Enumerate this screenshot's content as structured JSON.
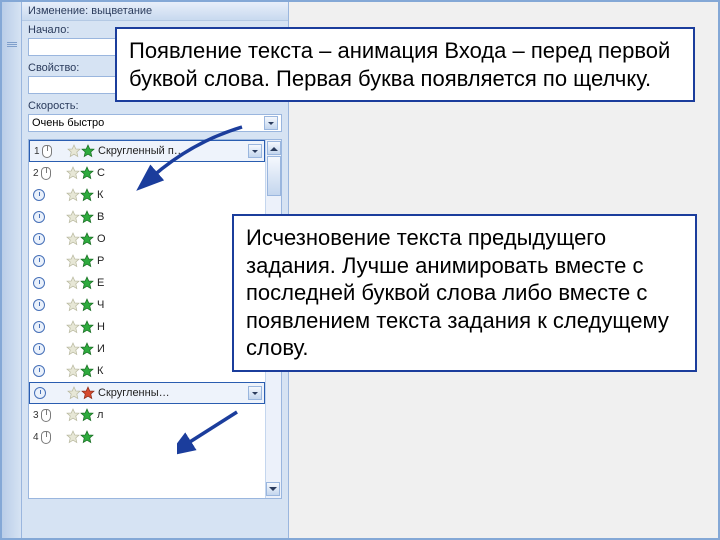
{
  "panel": {
    "title": "Изменение: выцветание",
    "start_label": "Начало:",
    "property_label": "Свойство:",
    "speed_label": "Скорость:",
    "speed_value": "Очень быстро"
  },
  "animations": [
    {
      "num": "1",
      "trigger": "mouse",
      "icons": [
        "ghost",
        "green"
      ],
      "label": "Скругленный п…",
      "selected": true
    },
    {
      "num": "2",
      "trigger": "mouse",
      "icons": [
        "ghost",
        "green"
      ],
      "label": "С"
    },
    {
      "num": "",
      "trigger": "clock",
      "icons": [
        "ghost",
        "green"
      ],
      "label": "К"
    },
    {
      "num": "",
      "trigger": "clock",
      "icons": [
        "ghost",
        "green"
      ],
      "label": "В"
    },
    {
      "num": "",
      "trigger": "clock",
      "icons": [
        "ghost",
        "green"
      ],
      "label": "О"
    },
    {
      "num": "",
      "trigger": "clock",
      "icons": [
        "ghost",
        "green"
      ],
      "label": "Р"
    },
    {
      "num": "",
      "trigger": "clock",
      "icons": [
        "ghost",
        "green"
      ],
      "label": "Е"
    },
    {
      "num": "",
      "trigger": "clock",
      "icons": [
        "ghost",
        "green"
      ],
      "label": "Ч"
    },
    {
      "num": "",
      "trigger": "clock",
      "icons": [
        "ghost",
        "green"
      ],
      "label": "Н"
    },
    {
      "num": "",
      "trigger": "clock",
      "icons": [
        "ghost",
        "green"
      ],
      "label": "И"
    },
    {
      "num": "",
      "trigger": "clock",
      "icons": [
        "ghost",
        "green"
      ],
      "label": "К"
    },
    {
      "num": "",
      "trigger": "clock",
      "icons": [
        "ghost",
        "red"
      ],
      "label": "Скругленны…",
      "selected": true
    },
    {
      "num": "3",
      "trigger": "mouse",
      "icons": [
        "ghost",
        "green"
      ],
      "label": "л"
    },
    {
      "num": "4",
      "trigger": "mouse",
      "icons": [
        "ghost",
        "green"
      ],
      "label": ""
    }
  ],
  "callouts": {
    "top": "Появление текста – анимация Входа – перед первой буквой слова. Первая буква появляется по щелчку.",
    "mid": "Исчезновение текста предыдущего задания. Лучше анимировать вместе с последней буквой слова либо вместе с появлением текста задания к следущему слову."
  }
}
